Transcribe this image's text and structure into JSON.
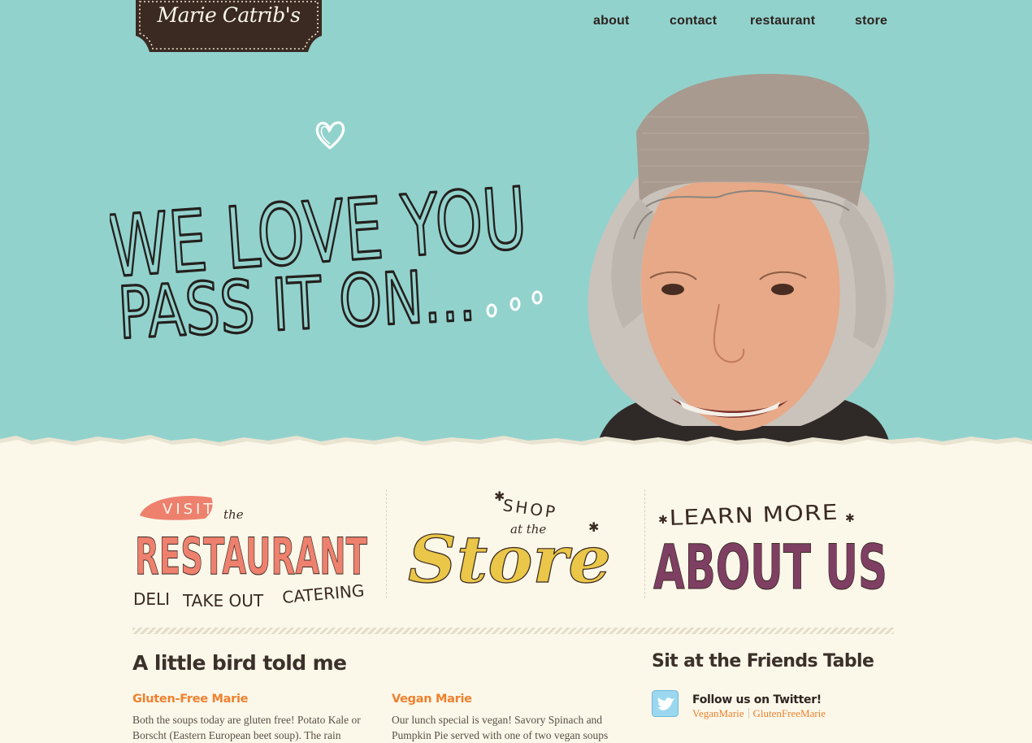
{
  "brand": {
    "logo_text": "Marie Catrib's"
  },
  "nav": {
    "items": [
      "about",
      "contact",
      "restaurant",
      "store"
    ]
  },
  "hero": {
    "line1": "WE LOVE YOU",
    "line2": "PASS IT ON...",
    "portrait_alt": "smiling woman in a cap"
  },
  "promos": {
    "restaurant": {
      "pre": "VISIT",
      "the": "the",
      "main": "RESTAURANT",
      "sub": [
        "DELI",
        "TAKE OUT",
        "CATERING"
      ]
    },
    "store": {
      "pre": "SHOP",
      "sub": "at the",
      "main": "Store"
    },
    "about": {
      "pre": "LEARN MORE",
      "main": "ABOUT US"
    }
  },
  "blog": {
    "heading": "A little bird told me",
    "posts": [
      {
        "title": "Gluten-Free Marie",
        "body": "Both the soups today are gluten free! Potato Kale or Borscht (Eastern European beet soup). The rain"
      },
      {
        "title": "Vegan Marie",
        "body": "Our lunch special is vegan! Savory Spinach and Pumpkin Pie served with one of two vegan soups"
      }
    ]
  },
  "friends": {
    "heading": "Sit at the Friends Table",
    "follow": "Follow us on Twitter!",
    "accounts": [
      "VeganMarie",
      "GlutenFreeMarie"
    ]
  },
  "colors": {
    "hero_bg": "#92d2cd",
    "paper": "#fbf8ea",
    "orange": "#f0802e",
    "coral": "#ee806e",
    "mustard": "#eac649",
    "plum": "#7e3f63",
    "ink": "#2c231f"
  }
}
